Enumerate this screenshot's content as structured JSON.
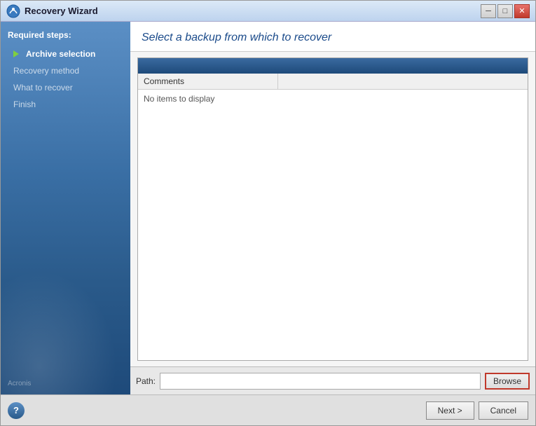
{
  "window": {
    "title": "Recovery Wizard",
    "title_btn_min": "─",
    "title_btn_max": "□",
    "title_btn_close": "✕"
  },
  "sidebar": {
    "section_title": "Required steps:",
    "items": [
      {
        "id": "archive-selection",
        "label": "Archive selection",
        "active": true
      },
      {
        "id": "recovery-method",
        "label": "Recovery method",
        "active": false
      },
      {
        "id": "what-to-recover",
        "label": "What to recover",
        "active": false
      },
      {
        "id": "finish",
        "label": "Finish",
        "active": false
      }
    ],
    "logo_text": "Acronis"
  },
  "main": {
    "header": "Select a backup from which to recover",
    "table": {
      "column_header": "Comments",
      "empty_message": "No items to display"
    },
    "path_label": "Path:",
    "path_value": "",
    "path_placeholder": "",
    "browse_label": "Browse"
  },
  "footer": {
    "next_label": "Next >",
    "cancel_label": "Cancel",
    "help_symbol": "?"
  }
}
